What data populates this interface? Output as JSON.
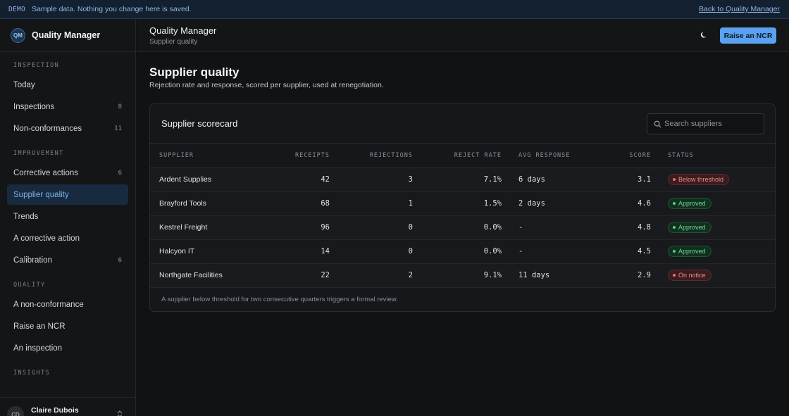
{
  "banner": {
    "tag": "DEMO",
    "message": "Sample data. Nothing you change here is saved.",
    "back_link": "Back to Quality Manager"
  },
  "sidebar": {
    "logo": "QM",
    "app_name": "Quality Manager",
    "sections": [
      {
        "label": "INSPECTION"
      },
      {
        "label": "IMPROVEMENT"
      },
      {
        "label": "QUALITY"
      },
      {
        "label": "INSIGHTS"
      }
    ],
    "items": [
      {
        "label": "Today",
        "count": ""
      },
      {
        "label": "Inspections",
        "count": "8"
      },
      {
        "label": "Non-conformances",
        "count": "11"
      },
      {
        "label": "Corrective actions",
        "count": "6"
      },
      {
        "label": "Supplier quality",
        "count": ""
      },
      {
        "label": "Trends",
        "count": ""
      },
      {
        "label": "A corrective action",
        "count": ""
      },
      {
        "label": "Calibration",
        "count": "6"
      },
      {
        "label": "A non-conformance",
        "count": ""
      },
      {
        "label": "Raise an NCR",
        "count": ""
      },
      {
        "label": "An inspection",
        "count": ""
      }
    ],
    "user": {
      "initials": "CD",
      "name": "Claire Dubois"
    }
  },
  "header": {
    "title": "Quality Manager",
    "subtitle": "Supplier quality",
    "theme_icon": "moon-icon",
    "primary_button": "Raise an NCR"
  },
  "page": {
    "title": "Supplier quality",
    "subtitle": "Rejection rate and response, scored per supplier, used at renegotiation."
  },
  "scorecard": {
    "title": "Supplier scorecard",
    "search_placeholder": "Search suppliers",
    "columns": [
      "SUPPLIER",
      "RECEIPTS",
      "REJECTIONS",
      "REJECT RATE",
      "AVG RESPONSE",
      "SCORE",
      "STATUS"
    ],
    "rows": [
      {
        "supplier": "Ardent Supplies",
        "receipts": "42",
        "rejections": "3",
        "reject_rate": "7.1%",
        "avg_response": "6 days",
        "score": "3.1",
        "status": "Below threshold",
        "status_kind": "bad"
      },
      {
        "supplier": "Brayford Tools",
        "receipts": "68",
        "rejections": "1",
        "reject_rate": "1.5%",
        "avg_response": "2 days",
        "score": "4.6",
        "status": "Approved",
        "status_kind": "ok"
      },
      {
        "supplier": "Kestrel Freight",
        "receipts": "96",
        "rejections": "0",
        "reject_rate": "0.0%",
        "avg_response": "-",
        "score": "4.8",
        "status": "Approved",
        "status_kind": "ok"
      },
      {
        "supplier": "Halcyon IT",
        "receipts": "14",
        "rejections": "0",
        "reject_rate": "0.0%",
        "avg_response": "-",
        "score": "4.5",
        "status": "Approved",
        "status_kind": "ok"
      },
      {
        "supplier": "Northgate Facilities",
        "receipts": "22",
        "rejections": "2",
        "reject_rate": "9.1%",
        "avg_response": "11 days",
        "score": "2.9",
        "status": "On notice",
        "status_kind": "bad"
      }
    ],
    "footnote": "A supplier below threshold for two consecutive quarters triggers a formal review."
  },
  "colors": {
    "accent": "#5aa2ef",
    "active_nav_bg": "#172a40",
    "status_bad": "#ef6b6b",
    "status_ok": "#4fcf86"
  }
}
